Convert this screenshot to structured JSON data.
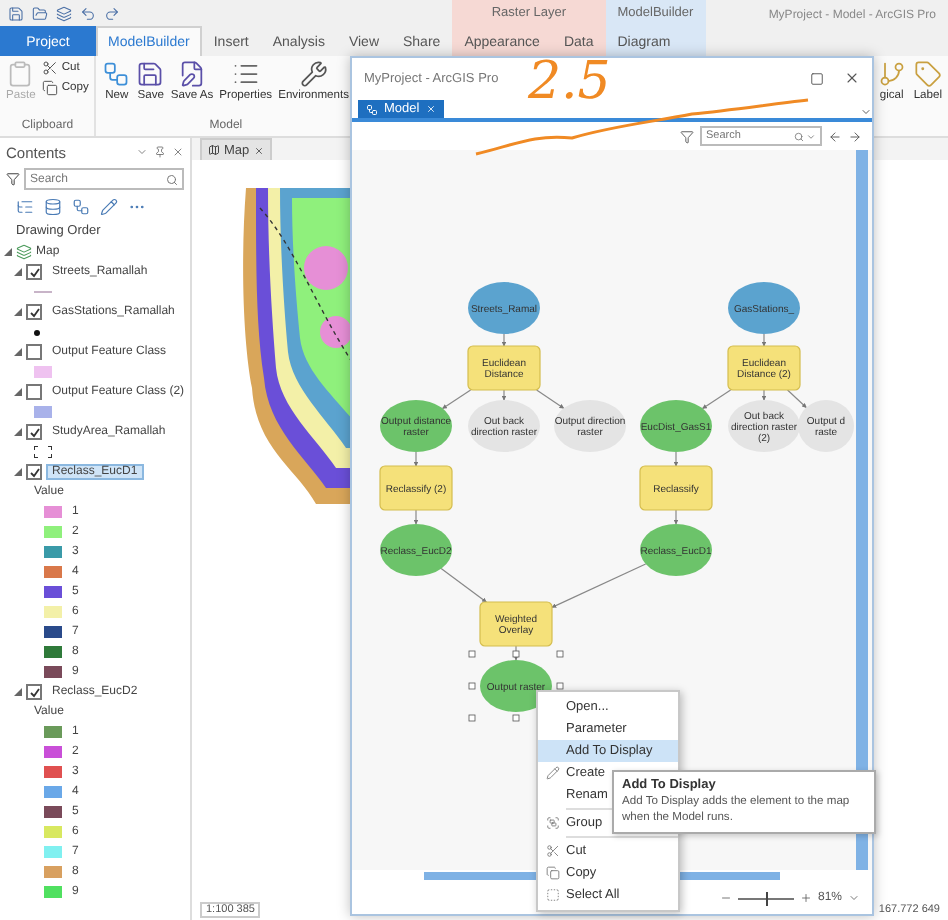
{
  "app": {
    "title": "MyProject - Model - ArcGIS Pro"
  },
  "ribbon": {
    "tabs": [
      {
        "label": "Project",
        "kind": "file",
        "selected": false
      },
      {
        "label": "ModelBuilder",
        "kind": "tab",
        "selected": true
      },
      {
        "label": "Insert",
        "kind": "tab",
        "selected": false
      },
      {
        "label": "Analysis",
        "kind": "tab",
        "selected": false
      },
      {
        "label": "View",
        "kind": "tab",
        "selected": false
      },
      {
        "label": "Share",
        "kind": "tab",
        "selected": false
      }
    ],
    "context_groups": [
      {
        "title": "Raster Layer",
        "color": "#f6d9d4",
        "tabs": [
          {
            "label": "Appearance",
            "selected": false
          },
          {
            "label": "Data",
            "selected": false
          }
        ]
      },
      {
        "title": "ModelBuilder",
        "color": "#d9e7f6",
        "tabs": [
          {
            "label": "Diagram",
            "selected": false
          }
        ]
      }
    ],
    "groups": [
      {
        "label": "Clipboard",
        "buttons": [
          {
            "label": "Paste",
            "disabled": true
          }
        ],
        "stack": [
          {
            "label": "Cut",
            "disabled": false
          },
          {
            "label": "Copy",
            "disabled": false
          }
        ]
      },
      {
        "label": "Model",
        "buttons": [
          {
            "label": "New",
            "disabled": false
          },
          {
            "label": "Save",
            "disabled": false
          },
          {
            "label": "Save As",
            "disabled": false
          },
          {
            "label": "Properties",
            "disabled": false
          },
          {
            "label": "Environments",
            "disabled": false
          }
        ]
      }
    ],
    "right_buttons": [
      {
        "label": "gical"
      },
      {
        "label": "Label"
      }
    ]
  },
  "contents": {
    "title": "Contents",
    "search": {
      "placeholder": "Search"
    },
    "heading": "Drawing Order",
    "tree": [
      {
        "label": "Map",
        "expanded": true,
        "children": [
          {
            "label": "Streets_Ramallah",
            "checked": true,
            "selected": false,
            "expanded": true,
            "symbol": {
              "kind": "line",
              "color": "#c8b4c8"
            }
          },
          {
            "label": "GasStations_Ramallah",
            "checked": true,
            "selected": false,
            "expanded": true,
            "symbol": {
              "kind": "point",
              "color": "#111111"
            }
          },
          {
            "label": "Output Feature Class",
            "checked": false,
            "selected": false,
            "expanded": true,
            "symbol": {
              "kind": "fill",
              "color": "#efc2f0"
            }
          },
          {
            "label": "Output Feature Class (2)",
            "checked": false,
            "selected": false,
            "expanded": true,
            "symbol": {
              "kind": "fill",
              "color": "#a9b2ea"
            }
          },
          {
            "label": "StudyArea_Ramallah",
            "checked": true,
            "selected": false,
            "expanded": true,
            "symbol": {
              "kind": "outline",
              "color": "#333333"
            }
          },
          {
            "label": "Reclass_EucD1",
            "checked": true,
            "selected": true,
            "expanded": true,
            "legend": {
              "heading": "Value",
              "classes": [
                {
                  "label": "1",
                  "color": "#e68fd6"
                },
                {
                  "label": "2",
                  "color": "#8ff07c"
                },
                {
                  "label": "3",
                  "color": "#3a9aa8"
                },
                {
                  "label": "4",
                  "color": "#d9784a"
                },
                {
                  "label": "5",
                  "color": "#6a4fd8"
                },
                {
                  "label": "6",
                  "color": "#f3f0a8"
                },
                {
                  "label": "7",
                  "color": "#2a4a8a"
                },
                {
                  "label": "8",
                  "color": "#2f7a3a"
                },
                {
                  "label": "9",
                  "color": "#7a4a5a"
                }
              ]
            }
          },
          {
            "label": "Reclass_EucD2",
            "checked": true,
            "selected": false,
            "expanded": true,
            "legend": {
              "heading": "Value",
              "classes": [
                {
                  "label": "1",
                  "color": "#6a9a5a"
                },
                {
                  "label": "2",
                  "color": "#c94fd8"
                },
                {
                  "label": "3",
                  "color": "#e05050"
                },
                {
                  "label": "4",
                  "color": "#6aa8e8"
                },
                {
                  "label": "5",
                  "color": "#7a4a5a"
                },
                {
                  "label": "6",
                  "color": "#d8e860"
                },
                {
                  "label": "7",
                  "color": "#80f0f0"
                },
                {
                  "label": "8",
                  "color": "#d8a060"
                },
                {
                  "label": "9",
                  "color": "#50e060"
                }
              ]
            }
          }
        ]
      }
    ]
  },
  "map_view": {
    "tab": {
      "label": "Map"
    },
    "scale": "1:100 385",
    "coordinates": "167.772 649"
  },
  "model_window": {
    "title": "MyProject - ArcGIS Pro",
    "tab": {
      "label": "Model"
    },
    "search": {
      "placeholder": "Search"
    },
    "nodes": [
      {
        "label": "Streets_Ramal",
        "kind": "input",
        "selected": false
      },
      {
        "label": "GasStations_",
        "kind": "input",
        "selected": false
      },
      {
        "label": "Euclidean Distance",
        "kind": "tool",
        "selected": false
      },
      {
        "label": "Euclidean Distance (2)",
        "kind": "tool",
        "selected": false
      },
      {
        "label": "Output distance raster",
        "kind": "output",
        "selected": false
      },
      {
        "label": "Out back direction raster",
        "kind": "intermediate",
        "selected": false
      },
      {
        "label": "Output direction raster",
        "kind": "intermediate",
        "selected": false
      },
      {
        "label": "EucDist_GasS1",
        "kind": "output",
        "selected": false
      },
      {
        "label": "Out back direction raster (2)",
        "kind": "intermediate",
        "selected": false
      },
      {
        "label": "Output d raste",
        "kind": "intermediate",
        "selected": false
      },
      {
        "label": "Reclassify (2)",
        "kind": "tool",
        "selected": false
      },
      {
        "label": "Reclassify",
        "kind": "tool",
        "selected": false
      },
      {
        "label": "Reclass_EucD2",
        "kind": "output",
        "selected": false
      },
      {
        "label": "Reclass_EucD1",
        "kind": "output",
        "selected": false
      },
      {
        "label": "Weighted Overlay",
        "kind": "tool",
        "selected": false
      },
      {
        "label": "Output raster",
        "kind": "output",
        "selected": true
      }
    ],
    "zoom": {
      "level": 0.5,
      "reading": "81%"
    }
  },
  "context_menu": {
    "sections": [
      {
        "items": [
          {
            "label": "Open...",
            "selected": false
          },
          {
            "label": "Parameter",
            "selected": false
          },
          {
            "label": "Add To Display",
            "selected": true
          },
          {
            "label": "Create",
            "selected": false
          },
          {
            "label": "Renam",
            "selected": false
          }
        ]
      },
      {
        "items": [
          {
            "label": "Group",
            "selected": false
          }
        ]
      },
      {
        "items": [
          {
            "label": "Cut",
            "selected": false
          },
          {
            "label": "Copy",
            "selected": false
          },
          {
            "label": "Select All",
            "selected": false
          }
        ]
      }
    ]
  },
  "tooltip": {
    "title": "Add To Display",
    "text": "Add To Display adds the element to the map when the Model runs."
  },
  "annotation": {
    "text": "2.5"
  }
}
